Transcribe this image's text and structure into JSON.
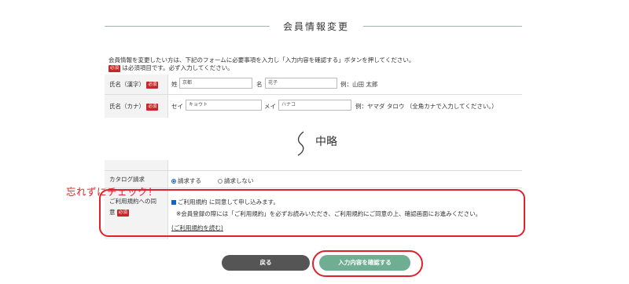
{
  "header": {
    "title": "会員情報変更"
  },
  "intro": {
    "line1": "会員情報を変更したい方は、下記のフォームに必要事項を入力し「入力内容を確認する」ボタンを押してください。",
    "required_badge": "必須",
    "line2": "は必須項目です。必ず入力してください。"
  },
  "name_kanji": {
    "label": "氏名（漢字）",
    "badge": "必須",
    "sei_label": "姓",
    "sei_value": "京都",
    "mei_label": "名",
    "mei_value": "花子",
    "example": "例：山田 太郎"
  },
  "name_kana": {
    "label": "氏名（カナ）",
    "badge": "必須",
    "sei_label": "セイ",
    "sei_value": "キョウト",
    "mei_label": "メイ",
    "mei_value": "ハナコ",
    "example": "例：ヤマダ タロウ （全角カナで入力してください。）"
  },
  "omission": {
    "text": "中略"
  },
  "catalog": {
    "label": "カタログ請求",
    "option_yes": "請求する",
    "option_no": "請求しない",
    "selected": "請求する"
  },
  "terms": {
    "label_line1": "ご利用規約への同",
    "label_line2": "意",
    "badge": "必須",
    "checkbox_label": "ご利用規約 に同意して申し込みます。",
    "checked": true,
    "note": "※会員登録の際には「ご利用規約」を必ずお読みいただき、ご利用規約にご同意の上、確認画面にお進みください。",
    "link": "(ご利用規約を読む)"
  },
  "callout": {
    "text": "忘れずにチェック！"
  },
  "buttons": {
    "back": "戻る",
    "confirm": "入力内容を確認する"
  },
  "colors": {
    "accent_green": "#6fae93",
    "back_gray": "#555555",
    "required_red": "#c62828",
    "highlight_red": "#e0202a"
  }
}
